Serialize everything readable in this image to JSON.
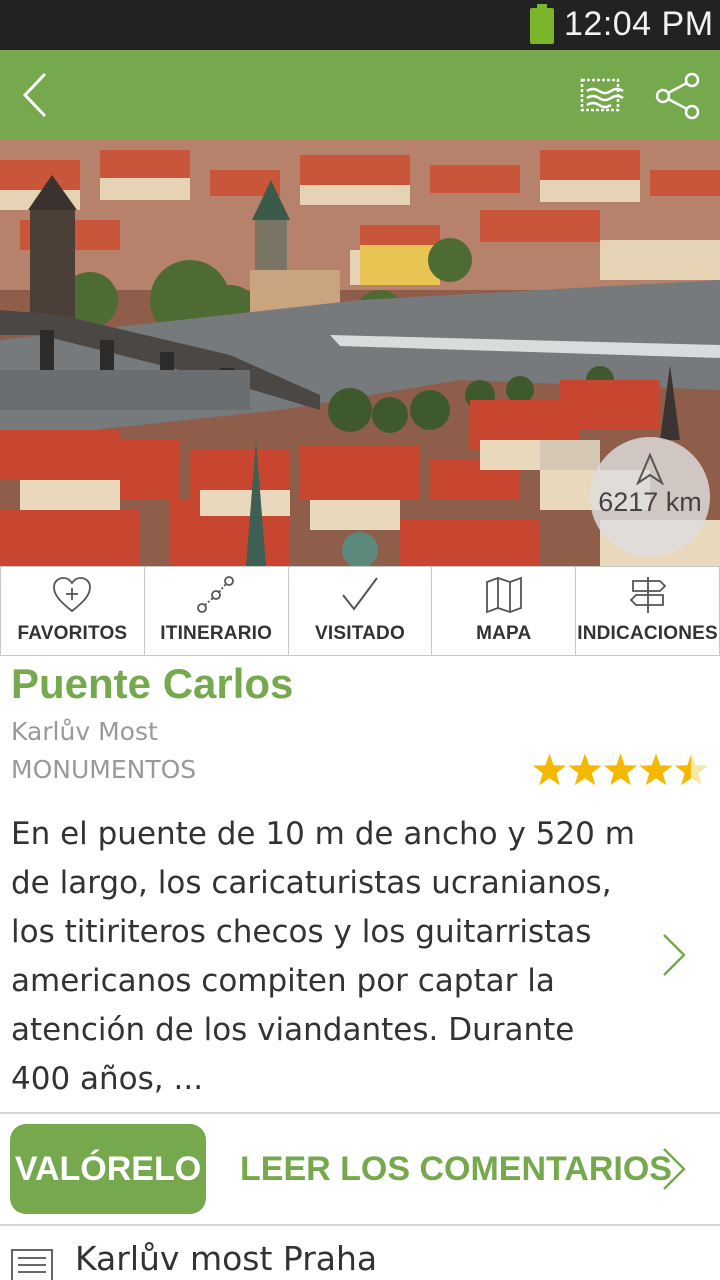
{
  "status_bar": {
    "time": "12:04 PM",
    "battery_icon": "battery-full-icon"
  },
  "app_bar": {
    "color": "#76a94e",
    "back_icon": "back-chevron-icon",
    "stamp_icon": "postcard-stamp-icon",
    "share_icon": "share-icon"
  },
  "hero": {
    "image": "aerial view of Charles Bridge and Prague old town",
    "distance": "6217 km",
    "distance_icon": "north-arrow-icon"
  },
  "actions": [
    {
      "label": "FAVORITOS",
      "icon": "heart-plus-icon"
    },
    {
      "label": "ITINERARIO",
      "icon": "route-icon"
    },
    {
      "label": "VISITADO",
      "icon": "checkmark-icon"
    },
    {
      "label": "MAPA",
      "icon": "map-icon"
    },
    {
      "label": "INDICACIONES",
      "icon": "signpost-icon"
    }
  ],
  "place": {
    "title": "Puente Carlos",
    "local_name": "Karlův Most",
    "category": "MONUMENTOS",
    "rating": 4.5,
    "rating_max": 5,
    "star_color": "#f5b800",
    "description": "En el puente de 10 m de ancho y 520 m de largo, los caricaturistas ucranianos, los titiriteros checos y los guitarristas americanos compiten por captar la atención de los viandantes. Durante 400 años, ..."
  },
  "review": {
    "rate_button": "VALÓRELO",
    "comments_link": "LEER LOS COMENTARIOS"
  },
  "info": {
    "text": "Karlův most Praha",
    "icon": "document-icon"
  }
}
